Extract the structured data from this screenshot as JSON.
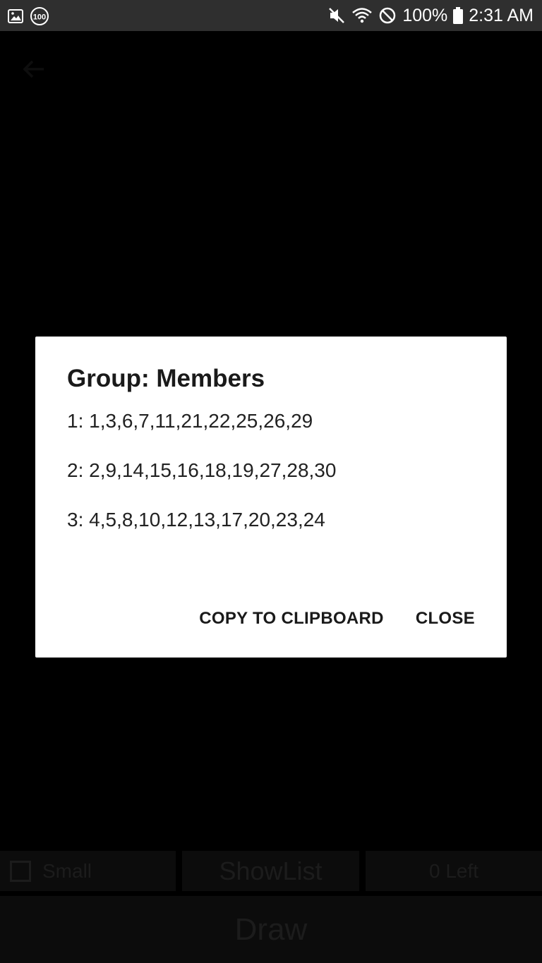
{
  "status_bar": {
    "battery_text": "100%",
    "time": "2:31 AM",
    "icons": [
      "image-icon",
      "hundred-icon",
      "mute-icon",
      "wifi-icon",
      "do-not-disturb-icon",
      "battery-icon"
    ]
  },
  "background_app": {
    "small_label": "Small",
    "showlist_label": "ShowList",
    "left_label": "0 Left",
    "draw_label": "Draw"
  },
  "dialog": {
    "title": "Group: Members",
    "lines": [
      "1: 1,3,6,7,11,21,22,25,26,29",
      "2: 2,9,14,15,16,18,19,27,28,30",
      "3: 4,5,8,10,12,13,17,20,23,24"
    ],
    "copy_button": "COPY TO CLIPBOARD",
    "close_button": "CLOSE"
  }
}
